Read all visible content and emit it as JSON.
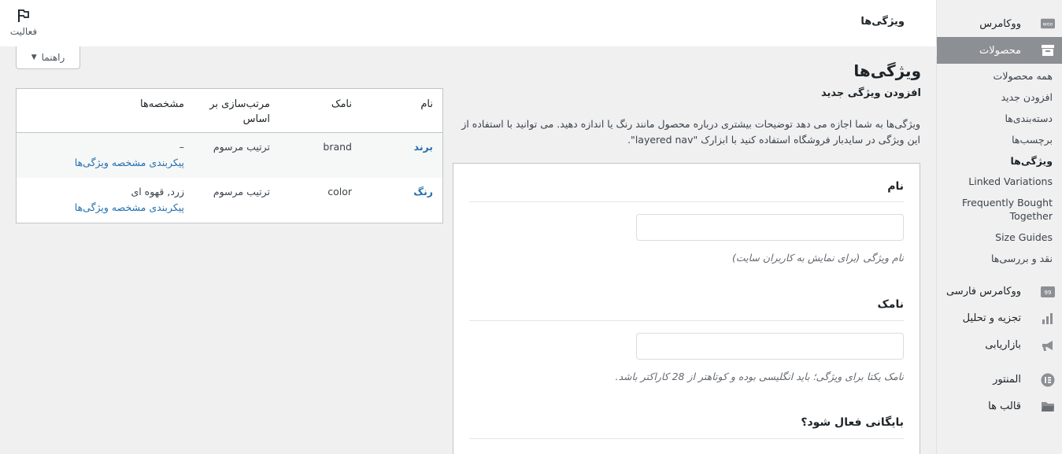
{
  "sidebar": {
    "woocommerce": "ووکامرس",
    "woo_badge": "woo",
    "products": "محصولات",
    "sub": [
      "همه محصولات",
      "افزودن جدید",
      "دسته‌بندی‌ها",
      "برچسب‌ها",
      "ویژگی‌ها",
      "Linked Variations",
      "Frequently Bought Together",
      "Size Guides",
      "نقد و بررسی‌ها"
    ],
    "woo_farsi": "ووکامرس فارسی",
    "analytics": "تجزیه و تحلیل",
    "marketing": "بازاریابی",
    "elementor": "المنتور",
    "templates": "قالب ها"
  },
  "topbar": {
    "title": "ویژگی‌ها",
    "activity": "فعالیت"
  },
  "help_button": "راهنما",
  "page": {
    "title": "ویژگی‌ها",
    "add_heading": "افزودن ویژگی جدید",
    "description": "ویژگی‌ها به شما اجازه می دهد توضیحات بیشتری درباره محصول مانند رنگ یا اندازه دهید. می توانید با استفاده از این ویژگی در سایدبار فروشگاه استفاده کنید با ابزارک \"layered nav\"."
  },
  "form": {
    "name_label": "نام",
    "name_value": "",
    "name_help": "نام ویژگی (برای نمایش به کاربران سایت)",
    "slug_label": "نامک",
    "slug_value": "",
    "slug_help": "نامک یکتا برای ویژگی؛ باید انگلیسی بوده و کوتاهتر از 28 کاراکتر باشد.",
    "archive_label": "بایگانی فعال شود؟"
  },
  "table": {
    "headers": [
      "نام",
      "نامک",
      "مرتب‌سازی بر اساس",
      "مشخصه‌ها"
    ],
    "rows": [
      {
        "name": "برند",
        "slug": "brand",
        "orderby": "ترتیب مرسوم",
        "terms": "–",
        "configure": "پیکربندی مشخصه ویژگی‌ها"
      },
      {
        "name": "رنگ",
        "slug": "color",
        "orderby": "ترتیب مرسوم",
        "terms": "زرد, قهوه ای",
        "configure": "پیکربندی مشخصه ویژگی‌ها"
      }
    ]
  },
  "colors": {
    "accent": "#2271b1",
    "sidebar_current": "#8c8f94"
  }
}
